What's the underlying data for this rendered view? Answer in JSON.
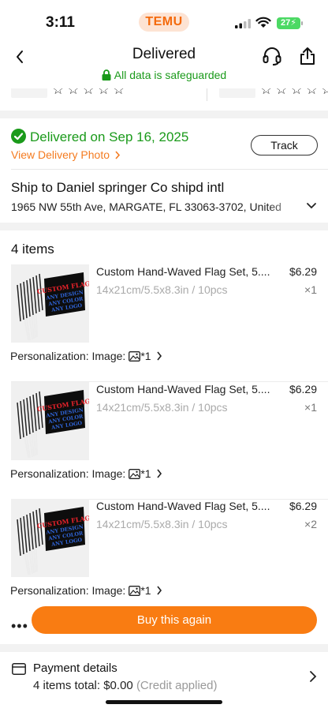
{
  "status_bar": {
    "time": "3:11",
    "app_badge": "TEMU",
    "battery": "27"
  },
  "header": {
    "title": "Delivered",
    "safeguard": "All data is safeguarded"
  },
  "delivery": {
    "status": "Delivered on Sep 16, 2025",
    "photo_link": "View Delivery Photo",
    "track_label": "Track",
    "ship_to": "Ship to Daniel springer Co shipd intl",
    "address": "1965 NW 55th Ave, MARGATE, FL 33063-3702, United"
  },
  "items_title": "4 items",
  "items": [
    {
      "name": "Custom Hand-Waved Flag Set, 5....",
      "price": "$6.29",
      "variant": "14x21cm/5.5x8.3in / 10pcs",
      "qty": "×1",
      "personalization": "Personalization: Image:",
      "count": "*1"
    },
    {
      "name": "Custom Hand-Waved Flag Set, 5....",
      "price": "$6.29",
      "variant": "14x21cm/5.5x8.3in / 10pcs",
      "qty": "×1",
      "personalization": "Personalization: Image:",
      "count": "*1"
    },
    {
      "name": "Custom Hand-Waved Flag Set, 5....",
      "price": "$6.29",
      "variant": "14x21cm/5.5x8.3in / 10pcs",
      "qty": "×2",
      "personalization": "Personalization: Image:",
      "count": "*1"
    }
  ],
  "flag_text": {
    "line1": "CUSTOM FLAG",
    "line2": "ANY DESIGN",
    "line3": "ANY COLOR",
    "line4": "ANY LOGO"
  },
  "actions": {
    "more": "•••",
    "buy_again": "Buy this again"
  },
  "payment": {
    "title": "Payment details",
    "total_label": "4 items total:",
    "total": "$0.00",
    "note": "(Credit applied)"
  },
  "colors": {
    "accent": "#f97c12",
    "success": "#1a9a1a"
  }
}
